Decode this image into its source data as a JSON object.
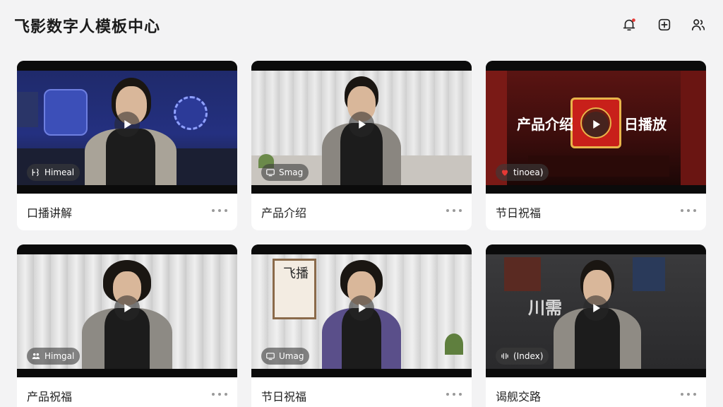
{
  "header": {
    "title": "飞影数字人模板中心",
    "icons": [
      "notification-bell-icon",
      "add-square-icon",
      "user-group-icon"
    ],
    "notification_dot_color": "#e53935"
  },
  "cards": [
    {
      "title": "口播讲解",
      "tag": "Himeal",
      "tag_icon": "digital-human-icon"
    },
    {
      "title": "产品介绍",
      "tag": "Smag",
      "tag_icon": "monitor-icon"
    },
    {
      "title": "节日祝福",
      "tag": "tinoea)",
      "tag_icon": "heart-icon",
      "overlay_left": "产品介绍",
      "overlay_right": "日播放"
    },
    {
      "title": "产品祝福",
      "tag": "Himgal",
      "tag_icon": "people-icon"
    },
    {
      "title": "节日祝福",
      "tag": "Umag",
      "tag_icon": "monitor-icon",
      "poster_text": "飞播"
    },
    {
      "title": "谒舰交路",
      "tag": "(Index)",
      "tag_icon": "audio-wave-icon",
      "overlay_text": "川需"
    }
  ],
  "theme": {
    "accent": "#e53935",
    "background": "#f3f3f4",
    "card": "#ffffff"
  }
}
